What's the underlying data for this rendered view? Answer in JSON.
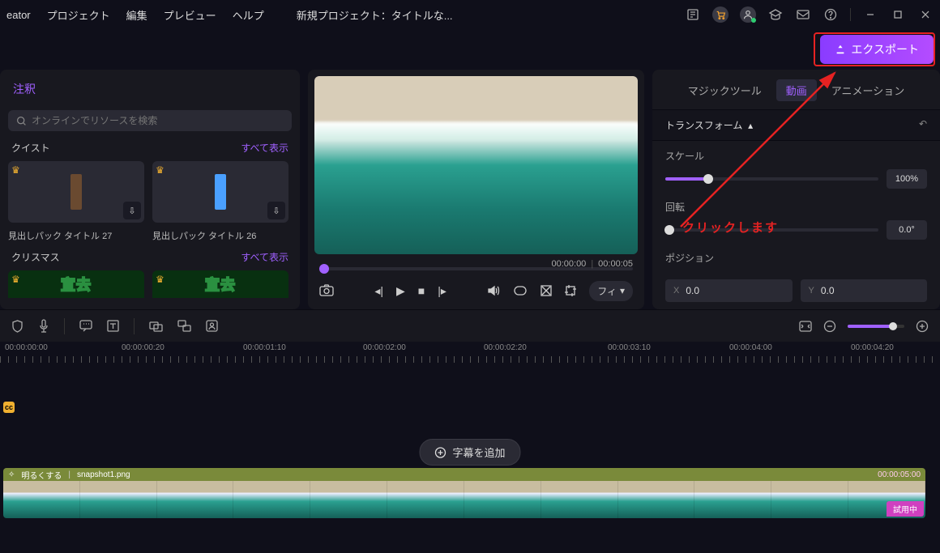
{
  "menu": {
    "app": "eator",
    "items": [
      "プロジェクト",
      "編集",
      "プレビュー",
      "ヘルプ"
    ],
    "project_title": "新規プロジェクト：タイトルな..."
  },
  "export_button_label": "エクスポート",
  "annotation_text": "クリックします",
  "left": {
    "tab": "注釈",
    "search_placeholder": "オンラインでリソースを検索",
    "cat1": "クイスト",
    "show_all": "すべて表示",
    "thumb1_label": "見出しパック タイトル 27",
    "thumb2_label": "見出しパック タイトル 26",
    "cat2": "クリスマス",
    "xmas1": "宣去",
    "xmas2": "宣去"
  },
  "preview": {
    "time_current": "00:00:00",
    "time_total": "00:00:05",
    "quality": "フィ"
  },
  "right": {
    "tabs": [
      "マジックツール",
      "動画",
      "アニメーション"
    ],
    "section": "トランスフォーム",
    "scale_label": "スケール",
    "scale_value": "100%",
    "rotate_label": "回転",
    "rotate_value": "0.0°",
    "position_label": "ポジション",
    "x_label": "X",
    "y_label": "Y",
    "x_value": "0.0",
    "y_value": "0.0"
  },
  "timeline": {
    "ticks": [
      "00:00:00:00",
      "00:00:00:20",
      "00:00:01:10",
      "00:00:02:00",
      "00:00:02:20",
      "00:00:03:10",
      "00:00:04:00",
      "00:00:04:20"
    ],
    "subtitle_btn": "字幕を追加",
    "clip_effect": "明るくする",
    "clip_name": "snapshot1.png",
    "clip_duration": "00:00:05:00",
    "trial": "試用中"
  }
}
